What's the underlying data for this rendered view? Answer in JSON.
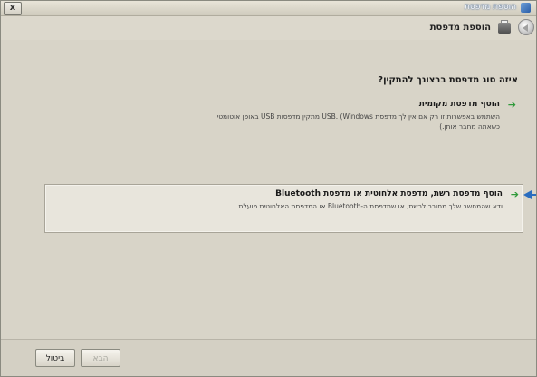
{
  "window": {
    "title": "הוספת מדפסת"
  },
  "titlebar": {
    "close_glyph": "x"
  },
  "nav": {
    "title": "הוספת מדפסת"
  },
  "main": {
    "question": "איזה סוג מדפסת ברצונך להתקין?",
    "options": [
      {
        "title": "הוסף מדפסת מקומית",
        "desc_line1": "השתמש באפשרות זו רק אם אין לך מדפסת USB. (Windows מתקין מדפסות USB באופן אוטומטי",
        "desc_line2": "כשאתה מחבר אותן.)"
      },
      {
        "title": "הוסף מדפסת רשת, מדפסת אלחוטית או מדפסת Bluetooth",
        "desc_line1": "ודא שהמחשב שלך מחובר לרשת, או שמדפסת ה-Bluetooth או המדפסת האלחוטית פועלת."
      }
    ]
  },
  "footer": {
    "cancel_label": "ביטול",
    "next_label": "הבא"
  }
}
